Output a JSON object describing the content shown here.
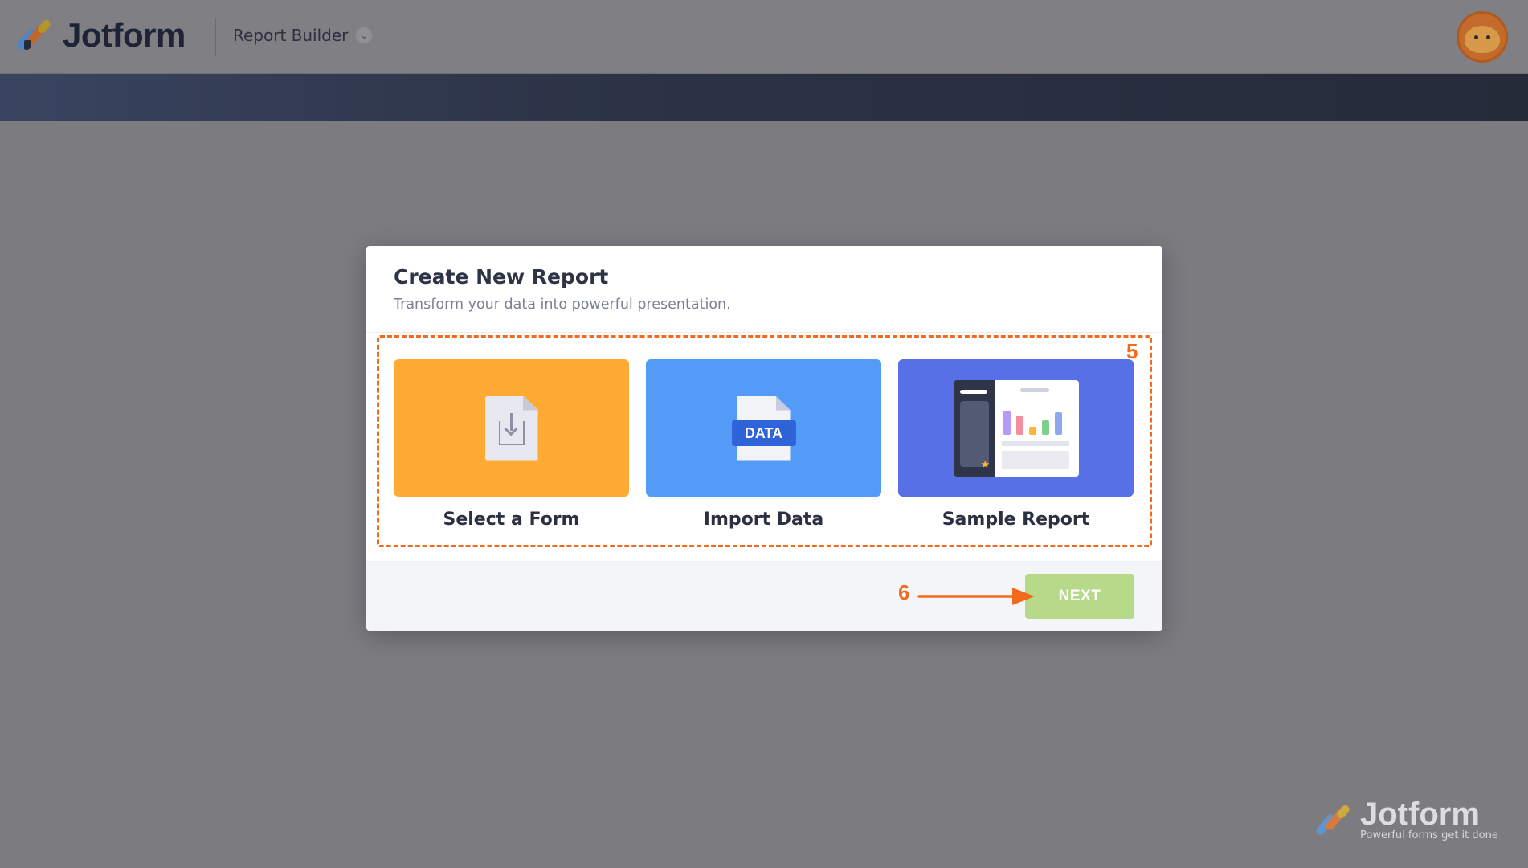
{
  "header": {
    "brand": "Jotform",
    "product_label": "Report Builder",
    "product_chevron_icon": "chevron-down-icon",
    "avatar_icon": "user-avatar"
  },
  "modal": {
    "title": "Create New Report",
    "subtitle": "Transform your data into powerful presentation.",
    "options": [
      {
        "label": "Select a Form",
        "icon": "form-download-icon",
        "color": "#ffab33"
      },
      {
        "label": "Import Data",
        "icon": "data-file-icon",
        "color": "#549bf8",
        "icon_text": "DATA"
      },
      {
        "label": "Sample Report",
        "icon": "report-preview-icon",
        "color": "#5770e6"
      }
    ],
    "next_label": "NEXT"
  },
  "annotations": {
    "step_options": "5",
    "step_next": "6",
    "color": "#f26b1d"
  },
  "watermark": {
    "brand": "Jotform",
    "tagline": "Powerful forms get it done"
  }
}
